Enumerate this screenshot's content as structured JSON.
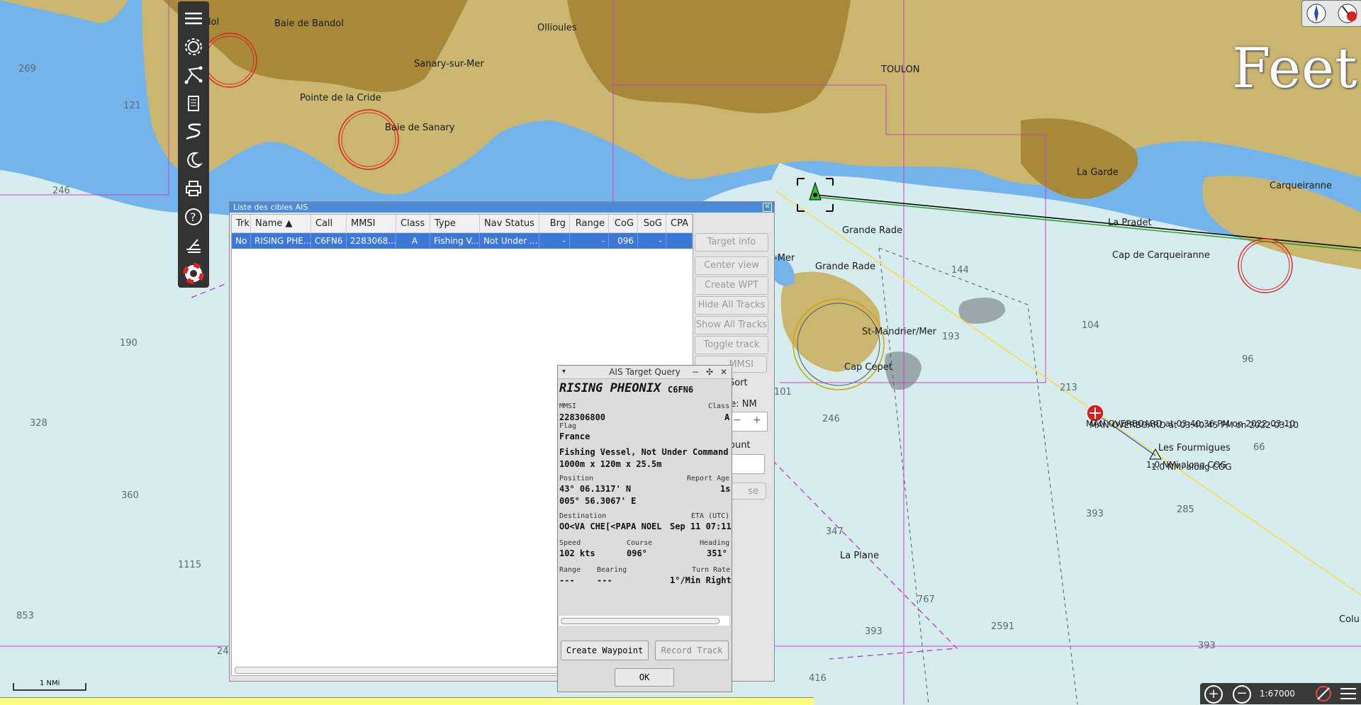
{
  "map": {
    "units_label": "Feet",
    "places": [
      {
        "id": "bandol",
        "text": "ndol"
      },
      {
        "id": "baie-bandol",
        "text": "Baie de Bandol"
      },
      {
        "id": "ollioules",
        "text": "Ollioules"
      },
      {
        "id": "sanary",
        "text": "Sanary-sur-Mer"
      },
      {
        "id": "toulon",
        "text": "TOULON"
      },
      {
        "id": "pointe-cride",
        "text": "Pointe de la Cride"
      },
      {
        "id": "baie-sanary",
        "text": "Baie de Sanary"
      },
      {
        "id": "la-garde",
        "text": "La Garde"
      },
      {
        "id": "carqueiranne",
        "text": "Carqueiranne"
      },
      {
        "id": "la-pradet",
        "text": "La Pradet"
      },
      {
        "id": "cap-carqueiranne",
        "text": "Cap de Carqueiranne"
      },
      {
        "id": "grande-rade-1",
        "text": "Grande Rade"
      },
      {
        "id": "grande-rade-2",
        "text": "Grande Rade"
      },
      {
        "id": "mer",
        "text": "-Mer"
      },
      {
        "id": "st-mandrier",
        "text": "St-Mandrier/Mer"
      },
      {
        "id": "cap-cepet",
        "text": "Cap Cepet"
      },
      {
        "id": "les-fourmigues",
        "text": "Les Fourmigues"
      },
      {
        "id": "la-plane",
        "text": "La Plane"
      },
      {
        "id": "colu",
        "text": "Colu"
      },
      {
        "id": "mob-1",
        "text": "MAN OVERBOARD at 03:40:36 PM on 2022-03-10"
      },
      {
        "id": "mob-2",
        "text": "MAN OVERBOARD at 03:40:45 PM on 2022-03-10"
      },
      {
        "id": "cog-1",
        "text": "1.0 NMi along COG"
      },
      {
        "id": "cog-2",
        "text": "1.0 NMi along COG"
      }
    ],
    "soundings": [
      "269",
      "121",
      "246",
      "190",
      "328",
      "360",
      "1115",
      "853",
      "24",
      "144",
      "193",
      "104",
      "96",
      "213",
      "66",
      "393",
      "285",
      "246",
      "347",
      "101",
      "767",
      "393",
      "2591",
      "393",
      "416"
    ],
    "scale_label": "1 NMi",
    "zoom_scale": "1:67000"
  },
  "toolbar": {
    "items": [
      {
        "name": "menu-icon"
      },
      {
        "name": "settings-icon"
      },
      {
        "name": "route-icon"
      },
      {
        "name": "document-icon"
      },
      {
        "name": "track-icon"
      },
      {
        "name": "night-mode-icon"
      },
      {
        "name": "print-icon"
      },
      {
        "name": "help-icon"
      },
      {
        "name": "mob-icon"
      },
      {
        "name": "lifebuoy-icon"
      }
    ]
  },
  "ais_list": {
    "title": "Liste des cibles AIS",
    "columns": [
      "Trk",
      "Name ▲",
      "Call",
      "MMSI",
      "Class",
      "Type",
      "Nav Status",
      "Brg",
      "Range",
      "CoG",
      "SoG",
      "CPA"
    ],
    "row": [
      "No",
      "RISING PHE...",
      "C6FN6",
      "2283068...",
      "A",
      "Fishing V...",
      "Not Under ...",
      "-",
      "-",
      "096",
      "-",
      ""
    ],
    "buttons": [
      "Target info",
      "Center view",
      "Create WPT",
      "Hide All Tracks",
      "Show All Tracks",
      "Toggle track",
      "MMSI"
    ],
    "sort_label": "Sort",
    "range_label": "ge: NM",
    "count_label": "ount",
    "close_label": "se"
  },
  "query": {
    "title": "AIS Target Query",
    "name": "RISING PHEONIX",
    "callsign": "C6FN6",
    "mmsi_label": "MMSI",
    "mmsi": "228306800",
    "class_label": "Class",
    "class": "A",
    "flag_label": "Flag",
    "flag": "France",
    "type_status": "Fishing Vessel, Not Under Command",
    "dimensions": "1000m x 120m x 25.5m",
    "position_label": "Position",
    "report_age_label": "Report Age",
    "lat": "43° 06.1317' N",
    "lon": "005° 56.3067' E",
    "report_age": "1s",
    "destination_label": "Destination",
    "destination": "OO<VA CHE[<PAPA NOEL",
    "eta_label": "ETA (UTC)",
    "eta": "Sep 11 07:11",
    "speed_label": "Speed",
    "speed": "102 kts",
    "course_label": "Course",
    "course": "096°",
    "heading_label": "Heading",
    "heading": "351°",
    "range_label": "Range",
    "range": "---",
    "bearing_label": "Bearing",
    "bearing": "---",
    "turn_rate_label": "Turn Rate",
    "turn_rate": "1°/Min Right",
    "create_waypoint": "Create Waypoint",
    "record_track": "Record Track",
    "ok": "OK"
  }
}
